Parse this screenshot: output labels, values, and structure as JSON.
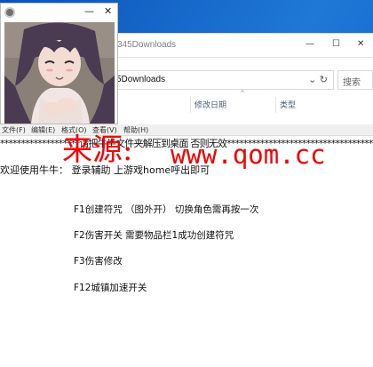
{
  "explorer": {
    "title": "345Downloads",
    "address": "5Downloads",
    "search_placeholder": "搜索",
    "columns": [
      "修改日期",
      "类型"
    ]
  },
  "console_window": {
    "menu": [
      "文件(F)",
      "编辑(E)",
      "格式(O)",
      "查看(V)",
      "帮助(H)"
    ],
    "star_line": "*******************请把牛牛文件夹解压到桌面 否则无效************************************",
    "welcome": "欢迎使用牛牛：  登录辅助 上游戏home呼出即可",
    "options": [
      "F1创建符咒  （图外开） 切换角色需再按一次",
      "F2伤害开关   需要物品栏1成功创建符咒",
      "F3伤害修改",
      "F12城镇加速开关"
    ]
  },
  "watermark": {
    "text": "来源:",
    "url": "www.qom.cc",
    "color": "#ff0000"
  },
  "colors": {
    "desktop_blue": "#0a52b8",
    "watermark_red": "#ff0000"
  }
}
